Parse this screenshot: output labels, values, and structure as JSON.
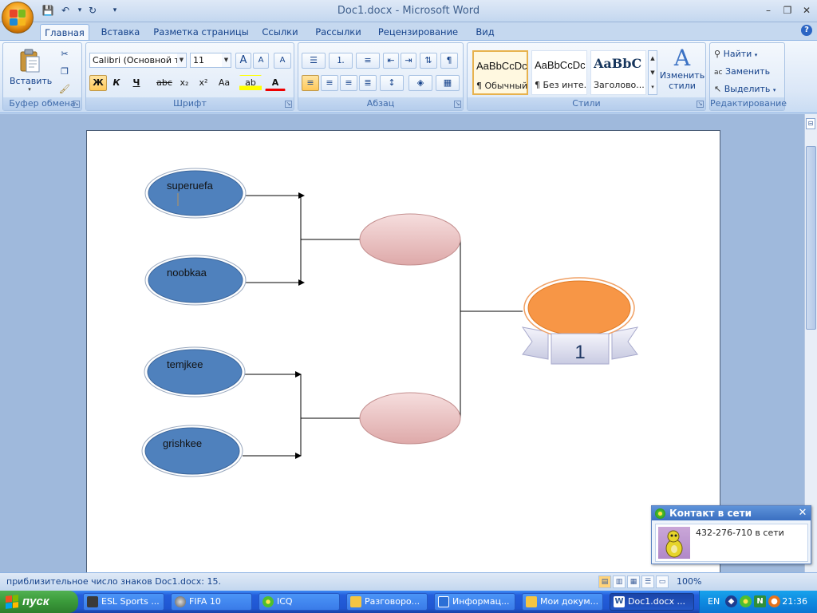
{
  "app": {
    "title": "Doc1.docx - Microsoft Word",
    "controls": {
      "minimize": "–",
      "restore": "❐",
      "close": "✕"
    }
  },
  "qat": {
    "save": "💾",
    "undo": "↶",
    "redo": "↻",
    "more": "▾"
  },
  "tabs": [
    {
      "label": "Главная",
      "active": true
    },
    {
      "label": "Вставка"
    },
    {
      "label": "Разметка страницы"
    },
    {
      "label": "Ссылки"
    },
    {
      "label": "Рассылки"
    },
    {
      "label": "Рецензирование"
    },
    {
      "label": "Вид"
    }
  ],
  "ribbon": {
    "clipboard": {
      "label": "Буфер обмена",
      "paste": "Вставить"
    },
    "font": {
      "label": "Шрифт",
      "font_name": "Calibri (Основной те",
      "font_size": "11",
      "grow": "A",
      "shrink": "A",
      "clear": "A",
      "bold": "Ж",
      "italic": "К",
      "underline": "Ч",
      "strike": "abc",
      "sub": "x₂",
      "sup": "x²",
      "case": "Aa",
      "highlight": "ab",
      "color": "A"
    },
    "paragraph": {
      "label": "Абзац"
    },
    "styles": {
      "label": "Стили",
      "items": [
        {
          "sample": "AaBbCcDc",
          "name": "¶ Обычный"
        },
        {
          "sample": "AaBbCcDc",
          "name": "¶ Без инте..."
        },
        {
          "sample": "AaBbC",
          "name": "Заголово..."
        }
      ],
      "change": "Изменить стили"
    },
    "editing": {
      "label": "Редактирование",
      "find": "Найти",
      "replace": "Заменить",
      "select": "Выделить"
    }
  },
  "bracket": {
    "players": [
      "superuefa",
      "noobkaa",
      "temjkee",
      "grishkee"
    ],
    "place": "1"
  },
  "status": {
    "text": "приблизительное число знаков Doc1.docx: 15.",
    "zoom": "100%"
  },
  "popup": {
    "title": "Контакт в сети",
    "message": "432-276-710 в сети",
    "close": "✕"
  },
  "taskbar": {
    "start": "пуск",
    "items": [
      {
        "label": "ESL Sports ..."
      },
      {
        "label": "FIFA 10"
      },
      {
        "label": "ICQ"
      },
      {
        "label": "Разговоро..."
      },
      {
        "label": "Информац..."
      },
      {
        "label": "Мои докум..."
      },
      {
        "label": "Doc1.docx ..."
      }
    ],
    "lang": "EN",
    "time": "21:36"
  },
  "colors": {
    "player_fill": "#4f81bd",
    "semi_fill": "#e8b9b9",
    "medal_fill": "#f79646",
    "accent": "#15428b"
  }
}
